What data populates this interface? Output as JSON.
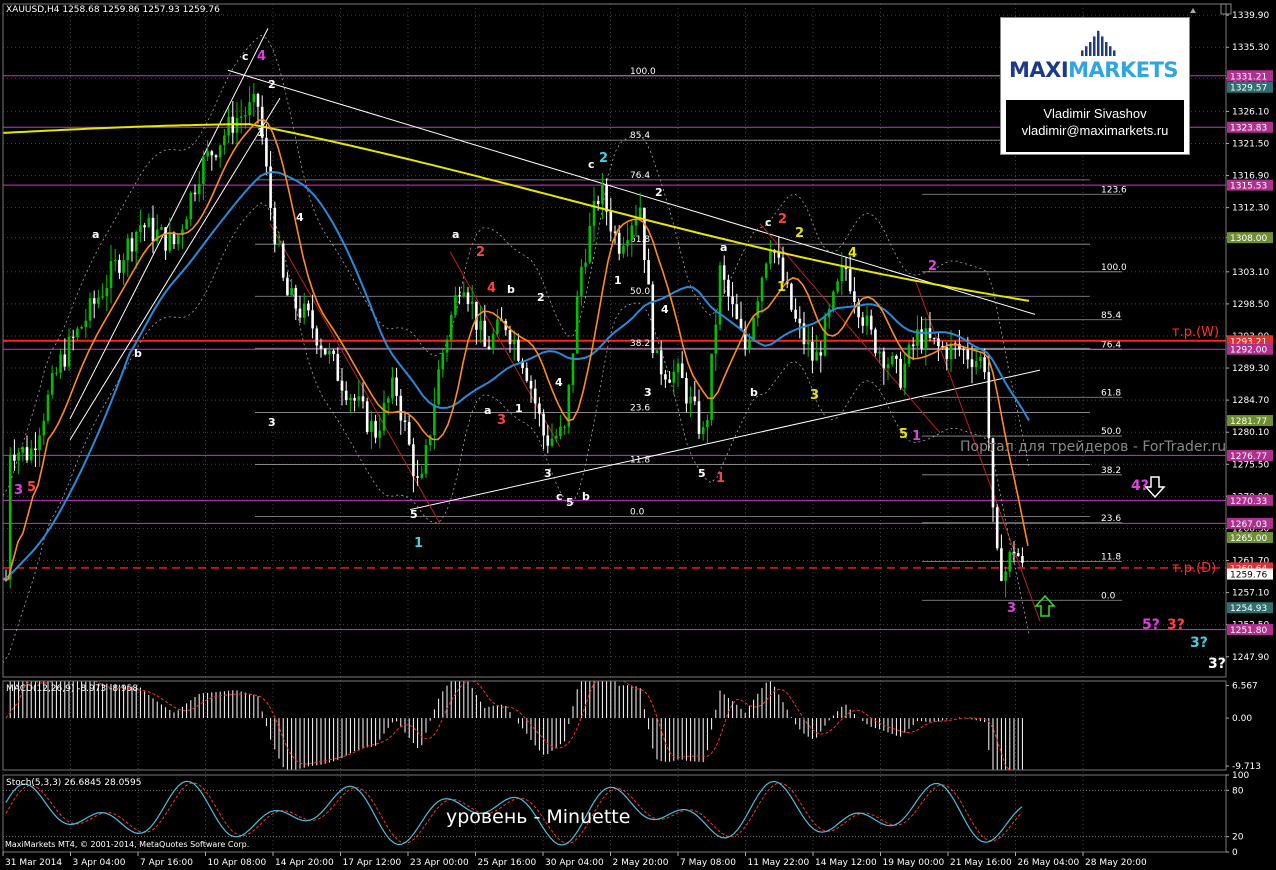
{
  "window": {
    "symbol_info": "XAUUSD,H4  1258.68  1259.86  1257.93  1259.76",
    "copyright": "MaxiMarkets MT4, © 2001-2014, MetaQuotes Software Corp."
  },
  "branding": {
    "logo_left": "MAXI",
    "logo_right": "MARKETS",
    "author_name": "Vladimir Sivashov",
    "author_email": "vladimir@maximarkets.ru",
    "watermark": "Портал для трейдеров - ForTrader.ru",
    "level_text": "уровень - Minuette"
  },
  "colors": {
    "background": "#000000",
    "bull_candle": "#00c000",
    "bear_candle": "#ffffff",
    "ma_yellow": "#e6e600",
    "ma_orange": "#ff8c1a",
    "ma_blue": "#2a8ad8",
    "red_line": "#ff2020",
    "magenta_line": "#cc33cc",
    "macd_hist": "#ffffff",
    "macd_signal": "#ff3030",
    "stoch_main": "#4ac0e0",
    "stoch_signal": "#ff3030"
  },
  "chart_data": {
    "type": "candlestick",
    "symbol": "XAUUSD",
    "timeframe": "H4",
    "ohlc_last": {
      "open": 1258.68,
      "high": 1259.86,
      "low": 1257.93,
      "close": 1259.76
    },
    "price_axis": {
      "min": 1245.0,
      "max": 1341.5,
      "ticks": [
        "1339.90",
        "1335.30",
        "1330.85",
        "1326.10",
        "1321.50",
        "1316.90",
        "1312.30",
        "1308.00",
        "1303.10",
        "1298.50",
        "1293.90",
        "1289.30",
        "1284.70",
        "1280.10",
        "1275.50",
        "1270.90",
        "1266.30",
        "1261.70",
        "1257.10",
        "1252.50",
        "1247.90"
      ]
    },
    "time_axis": [
      "31 Mar 2014",
      "3 Apr 04:00",
      "7 Apr 16:00",
      "10 Apr 08:00",
      "14 Apr 20:00",
      "17 Apr 12:00",
      "23 Apr 00:00",
      "25 Apr 16:00",
      "30 Apr 04:00",
      "2 May 20:00",
      "7 May 08:00",
      "11 May 22:00",
      "14 May 12:00",
      "19 May 00:00",
      "21 May 16:00",
      "26 May 04:00",
      "28 May 20:00"
    ],
    "price_boxes": [
      {
        "label": "1331.21",
        "price": 1331.21,
        "color": "#b03090"
      },
      {
        "label": "1329.57",
        "price": 1329.57,
        "color": "#2f6f6f"
      },
      {
        "label": "1323.83",
        "price": 1323.83,
        "color": "#b03090"
      },
      {
        "label": "1315.53",
        "price": 1315.53,
        "color": "#b03090"
      },
      {
        "label": "1308.00",
        "price": 1308.0,
        "color": "#6f8f30"
      },
      {
        "label": "1293.21",
        "price": 1293.21,
        "color": "#e03030"
      },
      {
        "label": "1292.00",
        "price": 1292.0,
        "color": "#b03090"
      },
      {
        "label": "1281.77",
        "price": 1281.77,
        "color": "#6f8f30"
      },
      {
        "label": "1276.77",
        "price": 1276.77,
        "color": "#b03090"
      },
      {
        "label": "1270.33",
        "price": 1270.33,
        "color": "#b03090"
      },
      {
        "label": "1267.03",
        "price": 1267.03,
        "color": "#b03090"
      },
      {
        "label": "1265.00",
        "price": 1265.0,
        "color": "#6f8f30"
      },
      {
        "label": "1260.64",
        "price": 1260.64,
        "color": "#e03030"
      },
      {
        "label": "1259.76",
        "price": 1259.76,
        "color": "#ffffff"
      },
      {
        "label": "1254.93",
        "price": 1254.93,
        "color": "#2f6f6f"
      },
      {
        "label": "1251.80",
        "price": 1251.8,
        "color": "#b03090"
      }
    ],
    "horizontal_lines": [
      {
        "name": "tp-w",
        "price": 1293.21,
        "color": "#ff2020",
        "style": "solid",
        "label": "т.р.(W)"
      },
      {
        "name": "tp-d",
        "price": 1260.64,
        "color": "#ff2020",
        "style": "dashed",
        "label": "т.р.(D)"
      },
      {
        "name": "level-1331",
        "price": 1331.21,
        "color": "#cc33cc",
        "style": "solid",
        "label": ""
      },
      {
        "name": "level-1323",
        "price": 1323.83,
        "color": "#cc33cc",
        "style": "solid",
        "label": ""
      },
      {
        "name": "level-1315",
        "price": 1315.53,
        "color": "#cc33cc",
        "style": "solid",
        "label": ""
      },
      {
        "name": "level-1292",
        "price": 1292.0,
        "color": "#cc33cc",
        "style": "solid",
        "label": ""
      },
      {
        "name": "level-1276",
        "price": 1276.77,
        "color": "#cc33cc",
        "style": "solid",
        "label": ""
      },
      {
        "name": "level-1270",
        "price": 1270.33,
        "color": "#cc33cc",
        "style": "solid",
        "label": ""
      },
      {
        "name": "level-1267",
        "price": 1267.03,
        "color": "#cc33cc",
        "style": "solid",
        "label": ""
      },
      {
        "name": "level-1251",
        "price": 1251.8,
        "color": "#cc33cc",
        "style": "solid",
        "label": ""
      }
    ],
    "fib_left": {
      "labels": [
        "100.0",
        "85.4",
        "76.4",
        "61.8",
        "50.0",
        "38.2",
        "23.6",
        "11.8",
        "0.0"
      ],
      "high": 1331.2,
      "low": 1268.0
    },
    "fib_right": {
      "labels": [
        "123.6",
        "100.0",
        "85.4",
        "76.4",
        "61.8",
        "50.0",
        "38.2",
        "23.6",
        "11.8",
        "0.0"
      ],
      "high": 1303.1,
      "low": 1256.0
    },
    "wave_labels": [
      {
        "text": "c",
        "color": "#ffffff",
        "date_index": 0
      },
      {
        "text": "4",
        "color": "#e040e0",
        "date_index": 0
      },
      {
        "text": "2",
        "color": "#ffffff",
        "date_index": 0
      },
      {
        "text": "1",
        "color": "#ffffff",
        "date_index": 0
      },
      {
        "text": "4",
        "color": "#ffffff",
        "date_index": 0
      },
      {
        "text": "3",
        "color": "#ffffff",
        "date_index": 0
      },
      {
        "text": "a",
        "color": "#ffffff",
        "date_index": 0
      },
      {
        "text": "b",
        "color": "#ffffff",
        "date_index": 0
      },
      {
        "text": "3",
        "color": "#e040e0",
        "date_index": 0
      },
      {
        "text": "5",
        "color": "#ff4040",
        "date_index": 0
      },
      {
        "text": "5",
        "color": "#ffffff",
        "date_index": 0
      },
      {
        "text": "1",
        "color": "#40d0e0",
        "date_index": 0
      },
      {
        "text": "a",
        "color": "#ffffff",
        "date_index": 0
      },
      {
        "text": "2",
        "color": "#ff4040",
        "date_index": 0
      },
      {
        "text": "4",
        "color": "#ff4040",
        "date_index": 0
      },
      {
        "text": "b",
        "color": "#ffffff",
        "date_index": 0
      },
      {
        "text": "2",
        "color": "#ffffff",
        "date_index": 0
      },
      {
        "text": "3",
        "color": "#ff4040",
        "date_index": 0
      },
      {
        "text": "a",
        "color": "#ffffff",
        "date_index": 0
      },
      {
        "text": "1",
        "color": "#ffffff",
        "date_index": 0
      },
      {
        "text": "4",
        "color": "#ffffff",
        "date_index": 0
      },
      {
        "text": "3",
        "color": "#ffffff",
        "date_index": 0
      },
      {
        "text": "c",
        "color": "#ffffff",
        "date_index": 0
      },
      {
        "text": "5",
        "color": "#ffffff",
        "date_index": 0
      },
      {
        "text": "b",
        "color": "#ffffff",
        "date_index": 0
      },
      {
        "text": "c",
        "color": "#ffffff",
        "date_index": 0
      },
      {
        "text": "2",
        "color": "#40d0e0",
        "date_index": 0
      },
      {
        "text": "2",
        "color": "#ffffff",
        "date_index": 0
      },
      {
        "text": "1",
        "color": "#ffffff",
        "date_index": 0
      },
      {
        "text": "4",
        "color": "#ffffff",
        "date_index": 0
      },
      {
        "text": "3",
        "color": "#ffffff",
        "date_index": 0
      },
      {
        "text": "5",
        "color": "#ffffff",
        "date_index": 0
      },
      {
        "text": "1",
        "color": "#ff4040",
        "date_index": 0
      },
      {
        "text": "a",
        "color": "#ffffff",
        "date_index": 0
      },
      {
        "text": "b",
        "color": "#ffffff",
        "date_index": 0
      },
      {
        "text": "c",
        "color": "#ffffff",
        "date_index": 0
      },
      {
        "text": "2",
        "color": "#ff4040",
        "date_index": 0
      },
      {
        "text": "2",
        "color": "#e6e600",
        "date_index": 0
      },
      {
        "text": "1",
        "color": "#e6e600",
        "date_index": 0
      },
      {
        "text": "3",
        "color": "#e6e600",
        "date_index": 0
      },
      {
        "text": "4",
        "color": "#e6e600",
        "date_index": 0
      },
      {
        "text": "2",
        "color": "#e040e0",
        "date_index": 0
      },
      {
        "text": "5",
        "color": "#e6e600",
        "date_index": 0
      },
      {
        "text": "1",
        "color": "#e040e0",
        "date_index": 0
      },
      {
        "text": "4?",
        "color": "#e040e0",
        "date_index": 0
      },
      {
        "text": "3",
        "color": "#e040e0",
        "date_index": 0
      },
      {
        "text": "5?",
        "color": "#e040e0",
        "date_index": 0
      },
      {
        "text": "3?",
        "color": "#ff4040",
        "date_index": 0
      },
      {
        "text": "3?",
        "color": "#40d0e0",
        "date_index": 0
      },
      {
        "text": "3?",
        "color": "#ffffff",
        "date_index": 0
      }
    ],
    "macd": {
      "label": "MACD(12,26,9) -8.973 -8.958",
      "ticks": [
        "6.567",
        "0.00",
        "-9.713"
      ],
      "min": -10.5,
      "max": 7.5
    },
    "stoch": {
      "label": "Stoch(5,3,3) 26.6845 28.0595",
      "ticks": [
        "100",
        "80",
        "20",
        "0"
      ],
      "min": 0,
      "max": 100
    }
  }
}
